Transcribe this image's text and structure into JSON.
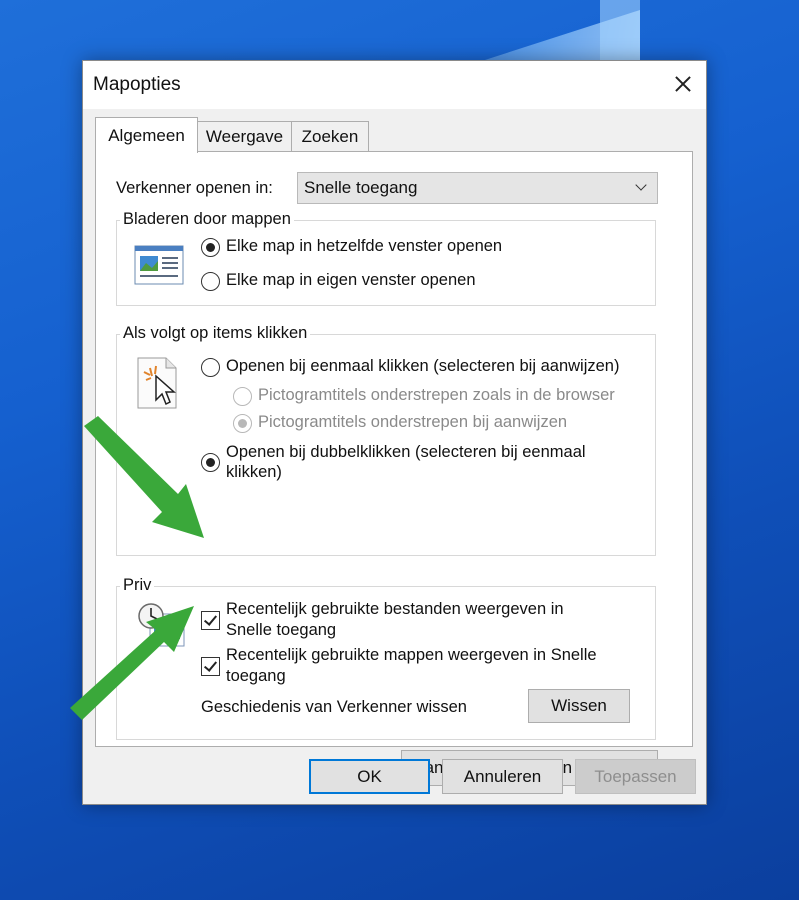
{
  "dialog": {
    "title": "Mapopties",
    "tabs": [
      "Algemeen",
      "Weergave",
      "Zoeken"
    ],
    "active_tab": "Algemeen"
  },
  "open_in": {
    "label": "Verkenner openen in:",
    "value": "Snelle toegang"
  },
  "browse": {
    "title": "Bladeren door mappen",
    "options": [
      {
        "label": "Elke map in hetzelfde venster openen",
        "selected": true
      },
      {
        "label": "Elke map in eigen venster openen",
        "selected": false
      }
    ]
  },
  "click": {
    "title": "Als volgt op items klikken",
    "single": "Openen bij eenmaal klikken (selecteren bij aanwijzen)",
    "underline_browser": "Pictogramtitels onderstrepen zoals in de browser",
    "underline_hover": "Pictogramtitels onderstrepen bij aanwijzen",
    "double_line1": "Openen bij dubbelklikken (selecteren bij eenmaal",
    "double_line2": "klikken)"
  },
  "privacy": {
    "title": "Priv",
    "recent_files_line1": "Recentelijk gebruikte bestanden weergeven in",
    "recent_files_line2": "Snelle toegang",
    "recent_folders_line1": "Recentelijk gebruikte mappen weergeven in Snelle",
    "recent_folders_line2": "toegang",
    "history_label": "Geschiedenis van Verkenner wissen",
    "clear_button": "Wissen"
  },
  "restore_button": "Standaardinstellingen herstellen",
  "footer": {
    "ok": "OK",
    "cancel": "Annuleren",
    "apply": "Toepassen"
  },
  "colors": {
    "accent": "#0078d7",
    "annotation_arrow": "#3aa83a"
  }
}
